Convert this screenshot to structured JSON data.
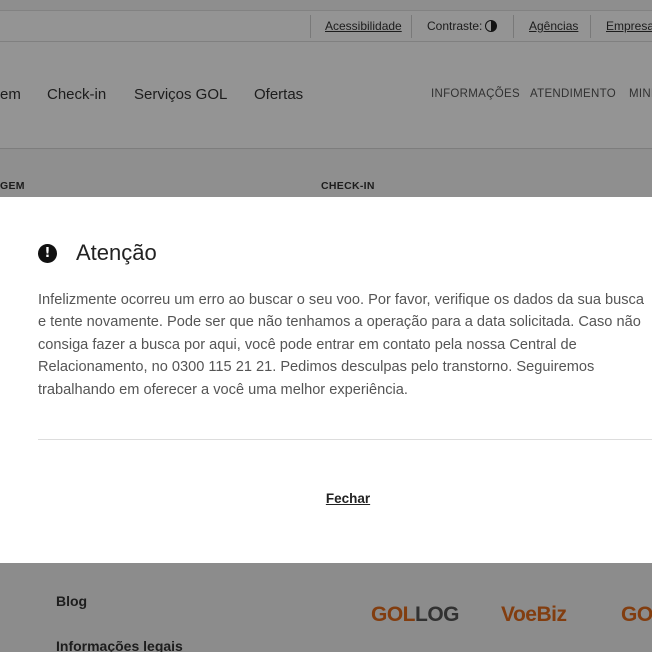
{
  "top_bar": {
    "accessibility": "Acessibilidade",
    "contrast": "Contraste:",
    "agencies": "Agências",
    "companies": "Empresas"
  },
  "main_nav": {
    "items": [
      "em",
      "Check-in",
      "Serviços GOL",
      "Ofertas"
    ],
    "secondary": [
      "INFORMAÇÕES",
      "ATENDIMENTO",
      "MINH"
    ]
  },
  "sub_row": {
    "left_label": "GEM",
    "right_label": "CHECK-IN"
  },
  "modal": {
    "title": "Atenção",
    "body": "Infelizmente ocorreu um erro ao buscar o seu voo. Por favor, verifique os dados da sua busca e tente novamente. Pode ser que não tenhamos a operação para a data solicitada. Caso não consiga fazer a busca por aqui, você pode entrar em contato pela nossa Central de Relacionamento, no 0300 115 21 21. Pedimos desculpas pelo transtorno. Seguiremos trabalhando em oferecer a você uma melhor experiência.",
    "close_label": "Fechar"
  },
  "footer": {
    "links": [
      "Blog",
      "Informações legais"
    ],
    "brands": {
      "gollog_main": "GOL",
      "gollog_suffix": "LOG",
      "voebiz": "VoeBiz",
      "partial": "GO"
    }
  },
  "colors": {
    "brand_orange": "#e06a1b",
    "overlay": "rgba(0,0,0,0.42)"
  }
}
